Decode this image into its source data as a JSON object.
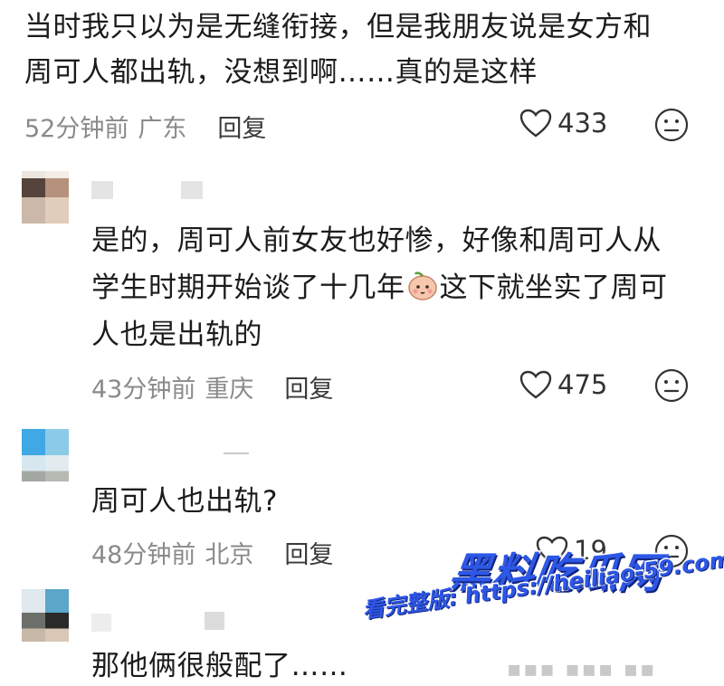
{
  "comments": [
    {
      "lines": [
        "当时我只以为是无缝衔接，但是我朋友说是女方和",
        "周可人都出轨，没想到啊……真的是这样"
      ],
      "time": "52分钟前",
      "location": "广东",
      "reply": "回复",
      "likes": "433"
    },
    {
      "lines": [
        "是的，周可人前女友也好惨，好像和周可人从",
        "学生时期开始谈了十几年",
        "这下就坐实了周可",
        "人也是出轨的"
      ],
      "time": "43分钟前",
      "location": "重庆",
      "reply": "回复",
      "likes": "475"
    },
    {
      "lines": [
        "周可人也出轨?"
      ],
      "time": "48分钟前",
      "location": "北京",
      "reply": "回复",
      "likes": "19"
    },
    {
      "lines": [
        "那他俩很般配了……"
      ]
    }
  ],
  "icons": {
    "like": "heart-outline-icon",
    "react": "smiley-face-icon",
    "emoji": "peach-face-emoji"
  },
  "watermark": {
    "brand": "黑料吃瓜网",
    "url_line": "看完整版: https://heiliao-59.com"
  },
  "colors": {
    "text": "#1c1c1c",
    "meta": "#8a8a8a",
    "watermark": "#2d57e6"
  }
}
